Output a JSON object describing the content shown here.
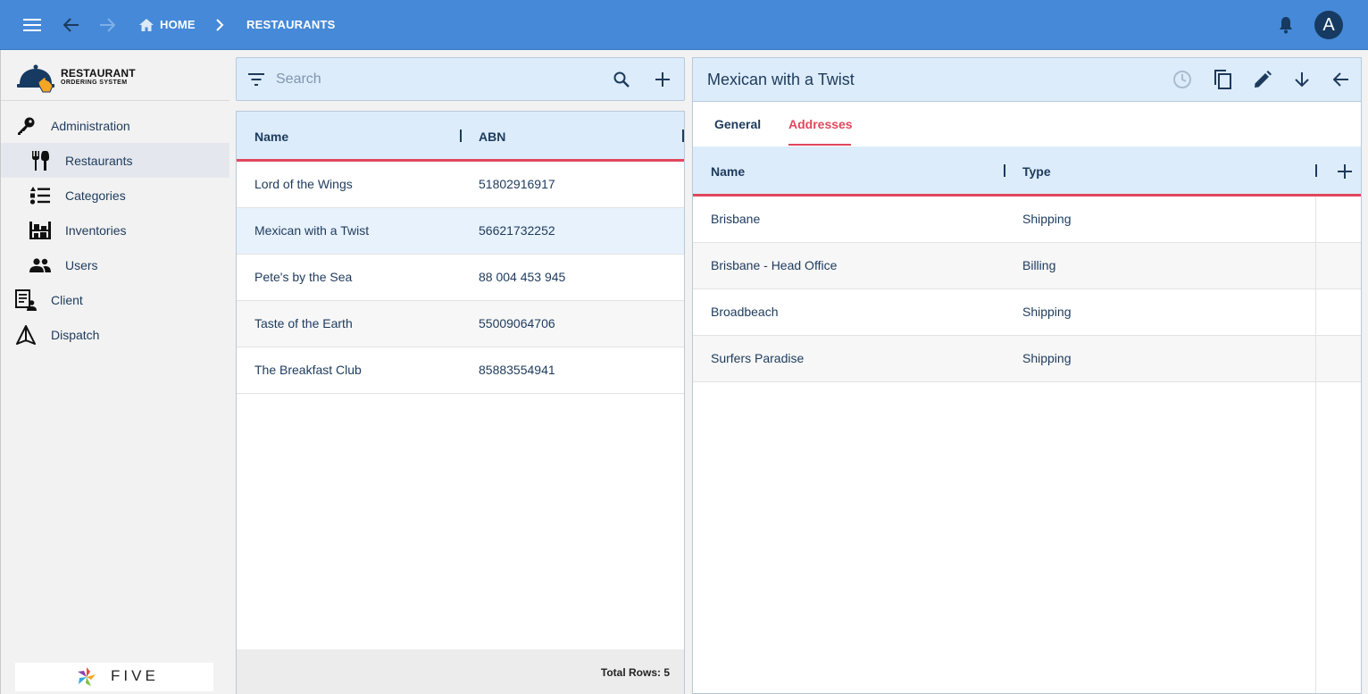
{
  "colors": {
    "topbar": "#4589d8",
    "accent_red": "#e0475e",
    "panel_header": "#dcecfb",
    "navy": "#1d3a5c",
    "selected_row": "#e8f2fc"
  },
  "topbar": {
    "icons": [
      "menu-icon",
      "back-arrow-icon",
      "forward-arrow-icon",
      "home-icon",
      "chevron-right-icon",
      "bell-icon"
    ],
    "breadcrumb": {
      "home": "HOME",
      "current": "RESTAURANTS"
    },
    "avatar_letter": "A"
  },
  "sidebar": {
    "logo": {
      "line1": "RESTAURANT",
      "line2": "ORDERING SYSTEM"
    },
    "items": [
      {
        "label": "Administration",
        "icon": "key-icon"
      },
      {
        "label": "Restaurants",
        "icon": "cutlery-icon"
      },
      {
        "label": "Categories",
        "icon": "list-icon"
      },
      {
        "label": "Inventories",
        "icon": "inventory-icon"
      },
      {
        "label": "Users",
        "icon": "users-icon"
      },
      {
        "label": "Client",
        "icon": "client-icon"
      },
      {
        "label": "Dispatch",
        "icon": "dispatch-icon"
      }
    ],
    "active_item": "Restaurants",
    "footer_logo": "FIVE"
  },
  "list": {
    "search_placeholder": "Search",
    "columns": [
      "Name",
      "ABN"
    ],
    "rows": [
      {
        "name": "Lord of the Wings",
        "abn": "51802916917"
      },
      {
        "name": "Mexican with a Twist",
        "abn": "56621732252"
      },
      {
        "name": "Pete's by the Sea",
        "abn": "88 004 453 945"
      },
      {
        "name": "Taste of the Earth",
        "abn": "55009064706"
      },
      {
        "name": "The Breakfast Club",
        "abn": "85883554941"
      }
    ],
    "selected_row": "Mexican with a Twist",
    "total_rows": "Total Rows: 5"
  },
  "detail": {
    "title": "Mexican with a Twist",
    "actions": [
      "history-icon",
      "copy-icon",
      "edit-icon",
      "arrow-down-icon",
      "arrow-back-icon"
    ],
    "tabs": [
      "General",
      "Addresses"
    ],
    "active_tab": "Addresses",
    "address_columns": [
      "Name",
      "Type"
    ],
    "addresses": [
      {
        "name": "Brisbane",
        "type": "Shipping"
      },
      {
        "name": "Brisbane - Head Office",
        "type": "Billing"
      },
      {
        "name": "Broadbeach",
        "type": "Shipping"
      },
      {
        "name": "Surfers Paradise",
        "type": "Shipping"
      }
    ]
  }
}
